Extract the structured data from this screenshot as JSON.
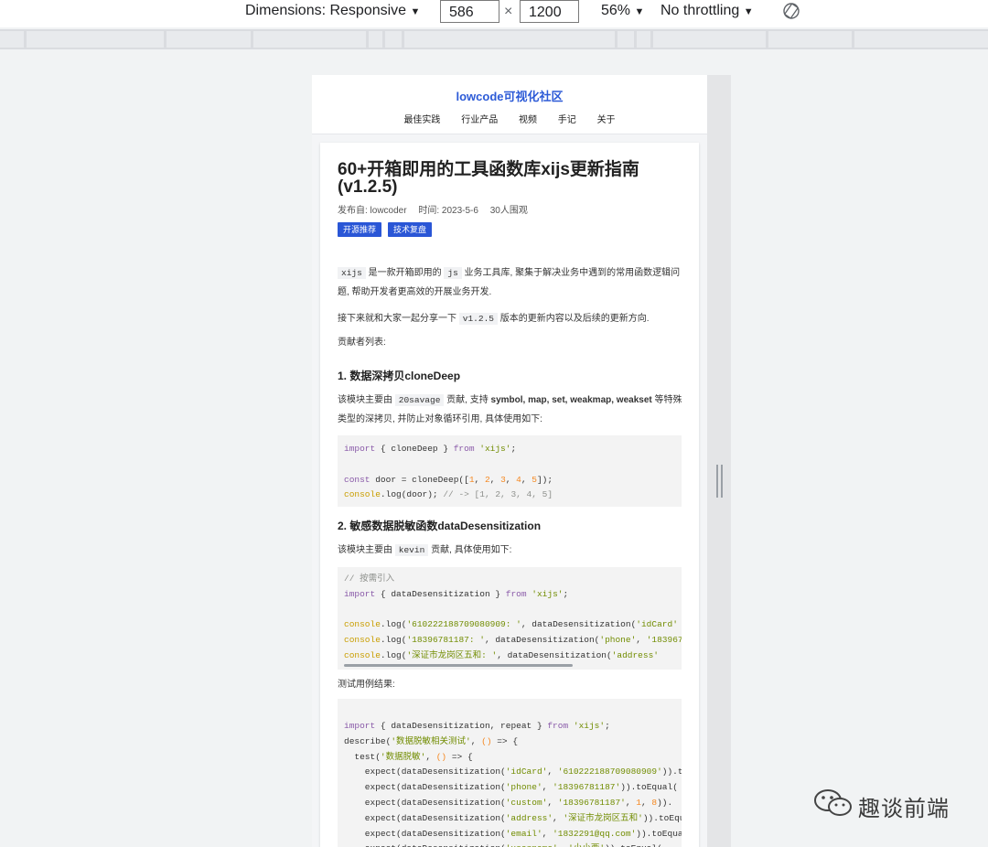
{
  "devtools": {
    "dimensions_label": "Dimensions: Responsive",
    "width_value": "586",
    "times": "×",
    "height_value": "1200",
    "zoom_label": "56%",
    "throttle_label": "No throttling",
    "caret": "▼"
  },
  "site": {
    "logo": "lowcode可视化社区",
    "nav": [
      "最佳实践",
      "行业产品",
      "视频",
      "手记",
      "关于"
    ]
  },
  "article": {
    "title": "60+开箱即用的工具函数库xijs更新指南(v1.2.5)",
    "meta": {
      "author": "发布自: lowcoder",
      "time": "时间: 2023-5-6",
      "views": "30人围观"
    },
    "tags": [
      "开源推荐",
      "技术复盘"
    ],
    "intro": {
      "code1": "xijs",
      "t1": " 是一款开箱即用的 ",
      "code2": "js",
      "t2": " 业务工具库, 聚集于解决业务中遇到的常用函数逻辑问题, 帮助开发者更高效的开展业务开发."
    },
    "p2": {
      "t1": "接下来就和大家一起分享一下 ",
      "code": "v1.2.5",
      "t2": " 版本的更新内容以及后续的更新方向."
    },
    "p3": "贡献者列表:",
    "h1": "1. 数据深拷贝cloneDeep",
    "s1": {
      "t1": "该模块主要由 ",
      "code": "20savage",
      "t2": " 贡献, 支持 ",
      "bold": "symbol, map, set, weakmap, weakset",
      "t3": " 等特殊类型的深拷贝, 并防止对象循环引用, 具体使用如下:"
    },
    "h2": "2. 敏感数据脱敏函数dataDesensitization",
    "s2": {
      "t1": "该模块主要由 ",
      "code": "kevin",
      "t2": " 贡献, 具体使用如下:"
    },
    "test_label": "测试用例结果:"
  },
  "watermark": "趣谈前端"
}
